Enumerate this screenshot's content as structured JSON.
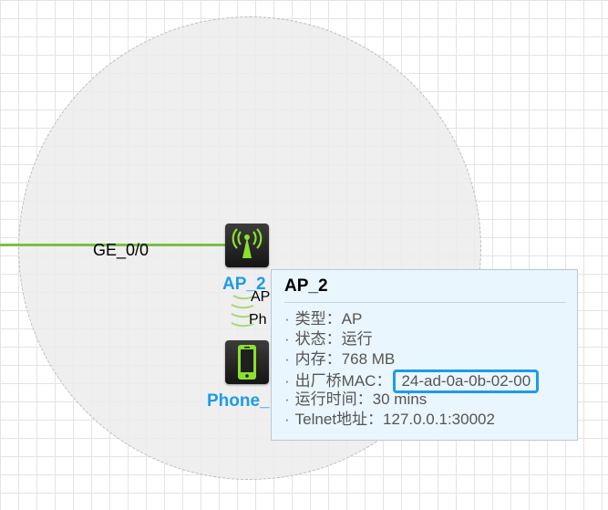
{
  "topology": {
    "link_label": "GE_0/0",
    "ap_label": "AP_2",
    "phone_label": "Phone_",
    "wireless_link_texts": [
      "AP",
      "Ph"
    ]
  },
  "tooltip": {
    "title": "AP_2",
    "rows": [
      {
        "label": "类型：",
        "value": "AP"
      },
      {
        "label": "状态：",
        "value": "运行"
      },
      {
        "label": "内存：",
        "value": "768 MB"
      },
      {
        "label": "出厂桥MAC：",
        "value": "24-ad-0a-0b-02-00"
      },
      {
        "label": "运行时间：",
        "value": "30 mins"
      },
      {
        "label": "Telnet地址：",
        "value": "127.0.0.1:30002"
      }
    ]
  },
  "icons": {
    "ap": "wireless-ap-icon",
    "phone": "mobile-phone-icon"
  },
  "colors": {
    "device_label": "#1e9be9",
    "link": "#7bc043",
    "highlight": "#1e9be9"
  }
}
